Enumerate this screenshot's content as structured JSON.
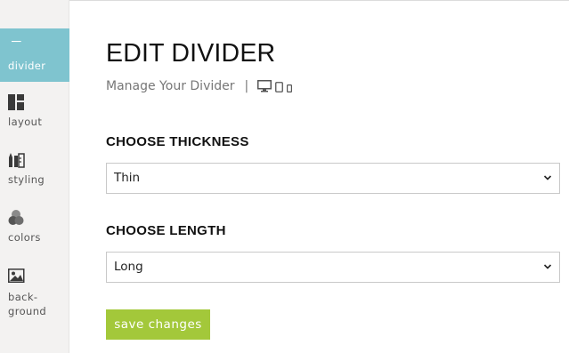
{
  "sidebar": {
    "items": [
      {
        "label": "divider",
        "icon": "divider-icon",
        "active": true
      },
      {
        "label": "layout",
        "icon": "layout-icon",
        "active": false
      },
      {
        "label": "styling",
        "icon": "styling-icon",
        "active": false
      },
      {
        "label": "colors",
        "icon": "colors-icon",
        "active": false
      },
      {
        "label_line1": "back-",
        "label_line2": "ground",
        "icon": "background-image-icon",
        "active": false
      }
    ]
  },
  "main": {
    "title": "EDIT DIVIDER",
    "subtitle": "Manage Your Divider",
    "separator": "|",
    "device_icons": [
      "desktop-icon",
      "tablet-icon",
      "phone-icon"
    ],
    "thickness": {
      "label": "CHOOSE THICKNESS",
      "value": "Thin"
    },
    "length": {
      "label": "CHOOSE LENGTH",
      "value": "Long"
    },
    "save_label": "save changes"
  },
  "colors": {
    "active_tab": "#7fc4cf",
    "save_button": "#a3c83a",
    "sidebar_bg": "#f3f2f1"
  }
}
